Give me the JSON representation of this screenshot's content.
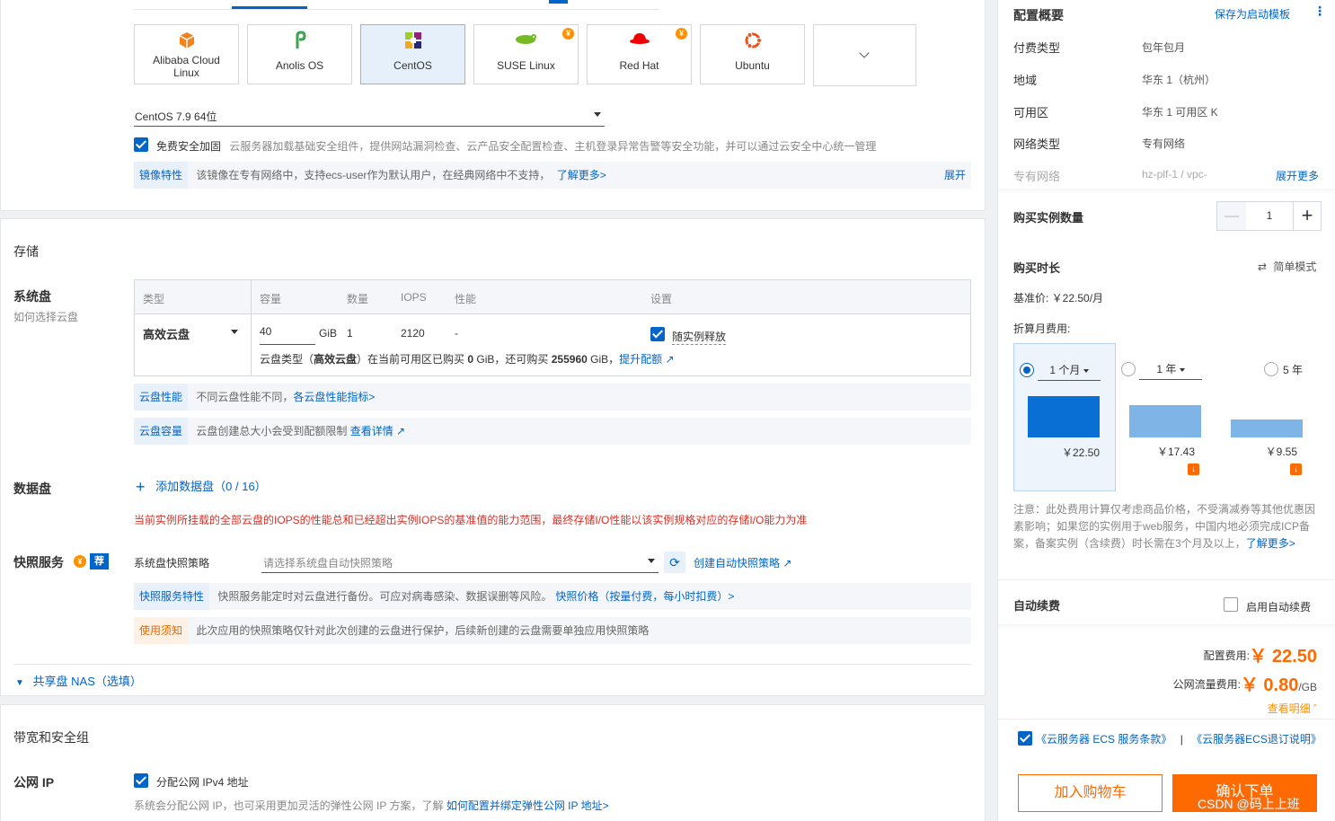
{
  "os_options": [
    {
      "name": "Alibaba Cloud Linux",
      "icon": "alibaba-cloud-icon"
    },
    {
      "name": "Anolis OS",
      "icon": "anolis-icon"
    },
    {
      "name": "CentOS",
      "icon": "centos-icon"
    },
    {
      "name": "SUSE Linux",
      "icon": "suse-icon"
    },
    {
      "name": "Red Hat",
      "icon": "redhat-icon"
    },
    {
      "name": "Ubuntu",
      "icon": "ubuntu-icon"
    }
  ],
  "image_version": "CentOS 7.9 64位",
  "security": {
    "label": "免费安全加固",
    "desc": "云服务器加载基础安全组件，提供网站漏洞检查、云产品安全配置检查、主机登录异常告警等安全功能，并可以通过云安全中心统一管理"
  },
  "image_feature": {
    "tag": "镜像特性",
    "text": "该镜像在专有网络中，支持ecs-user作为默认用户，在经典网络中不支持，",
    "link": "了解更多>",
    "expand": "展开"
  },
  "storage": {
    "title": "存储",
    "system_disk": {
      "label": "系统盘",
      "help": "如何选择云盘"
    },
    "table_headers": {
      "type": "类型",
      "capacity": "容量",
      "count": "数量",
      "iops": "IOPS",
      "perf": "性能",
      "settings": "设置"
    },
    "disk": {
      "type": "高效云盘",
      "capacity": "40",
      "unit": "GiB",
      "count": "1",
      "iops": "2120",
      "perf": "-",
      "release_label": "随实例释放"
    },
    "disk_note": {
      "pre": "云盘类型（",
      "type": "高效云盘",
      "mid": "）在当前可用区已购买 ",
      "bought": "0",
      "mid2": " GiB，还可购买 ",
      "remain": "255960",
      "mid3": " GiB，",
      "link": "提升配额"
    },
    "perf_bar": {
      "tag": "云盘性能",
      "text": "不同云盘性能不同，",
      "link": "各云盘性能指标>"
    },
    "cap_bar": {
      "tag": "云盘容量",
      "text": "云盘创建总大小会受到配额限制 ",
      "link": "查看详情"
    },
    "data_disk": {
      "label": "数据盘",
      "add": "添加数据盘",
      "count": "（0 / 16）"
    },
    "warning": "当前实例所挂载的全部云盘的IOPS的性能总和已经超出实例IOPS的基准值的能力范围，最终存储I/O性能以该实例规格对应的存储I/O能力为准",
    "snapshot": {
      "label": "快照服务",
      "rec": "荐",
      "policy_label": "系统盘快照策略",
      "placeholder": "请选择系统盘自动快照策略",
      "create": "创建自动快照策略"
    },
    "snap_feature": {
      "tag": "快照服务特性",
      "text": "快照服务能定时对云盘进行备份。可应对病毒感染、数据误删等风险。",
      "link": "快照价格（按量付费，每小时扣费）>"
    },
    "snap_notice": {
      "tag": "使用须知",
      "text": "此次应用的快照策略仅针对此次创建的云盘进行保护，后续新创建的云盘需要单独应用快照策略"
    },
    "nas": "共享盘 NAS（选填）"
  },
  "network": {
    "title": "带宽和安全组",
    "public_ip": {
      "label": "公网 IP",
      "check": "分配公网 IPv4 地址",
      "desc": "系统会分配公网 IP，也可采用更加灵活的弹性公网 IP 方案，了解 ",
      "link": "如何配置并绑定弹性公网 IP 地址>"
    }
  },
  "summary": {
    "title": "配置概要",
    "save_template": "保存为启动模板",
    "rows": [
      {
        "label": "付费类型",
        "value": "包年包月"
      },
      {
        "label": "地域",
        "value": "华东 1（杭州）"
      },
      {
        "label": "可用区",
        "value": "华东 1 可用区 K"
      },
      {
        "label": "网络类型",
        "value": "专有网络"
      }
    ],
    "vpc_label": "专有网络",
    "vpc_value": "hz-plf-1 / vpc-",
    "expand_more": "展开更多",
    "qty_label": "购买实例数量",
    "qty": "1",
    "duration_label": "购买时长",
    "simple_mode": "简单模式",
    "base_price": "基准价: ￥22.50/月",
    "monthly_label": "折算月费用:",
    "plans": [
      {
        "label": "1 个月",
        "price": "￥22.50",
        "value": 22.5,
        "selected": true
      },
      {
        "label": "1 年",
        "price": "￥17.43",
        "value": 17.43,
        "selected": false
      },
      {
        "label": "5 年",
        "price": "￥9.55",
        "value": 9.55,
        "selected": false
      }
    ],
    "note": "注意：此处费用计算仅考虑商品价格，不受满减券等其他优惠因素影响；如果您的实例用于web服务，中国内地必须完成ICP备案，备案实例（含续费）时长需在3个月及以上，",
    "note_link": "了解更多>",
    "auto_renew_label": "自动续费",
    "auto_renew_check": "启用自动续费",
    "config_fee_label": "配置费用:",
    "config_fee": "￥ 22.50",
    "traffic_label": "公网流量费用:",
    "traffic_fee": "￥ 0.80",
    "traffic_unit": "/GB",
    "detail": "查看明细",
    "terms1": "《云服务器 ECS 服务条款》",
    "terms_sep": "|",
    "terms2": "《云服务器ECS退订说明》",
    "add_cart": "加入购物车",
    "confirm": "确认下单",
    "watermark": "CSDN @码上上班"
  }
}
